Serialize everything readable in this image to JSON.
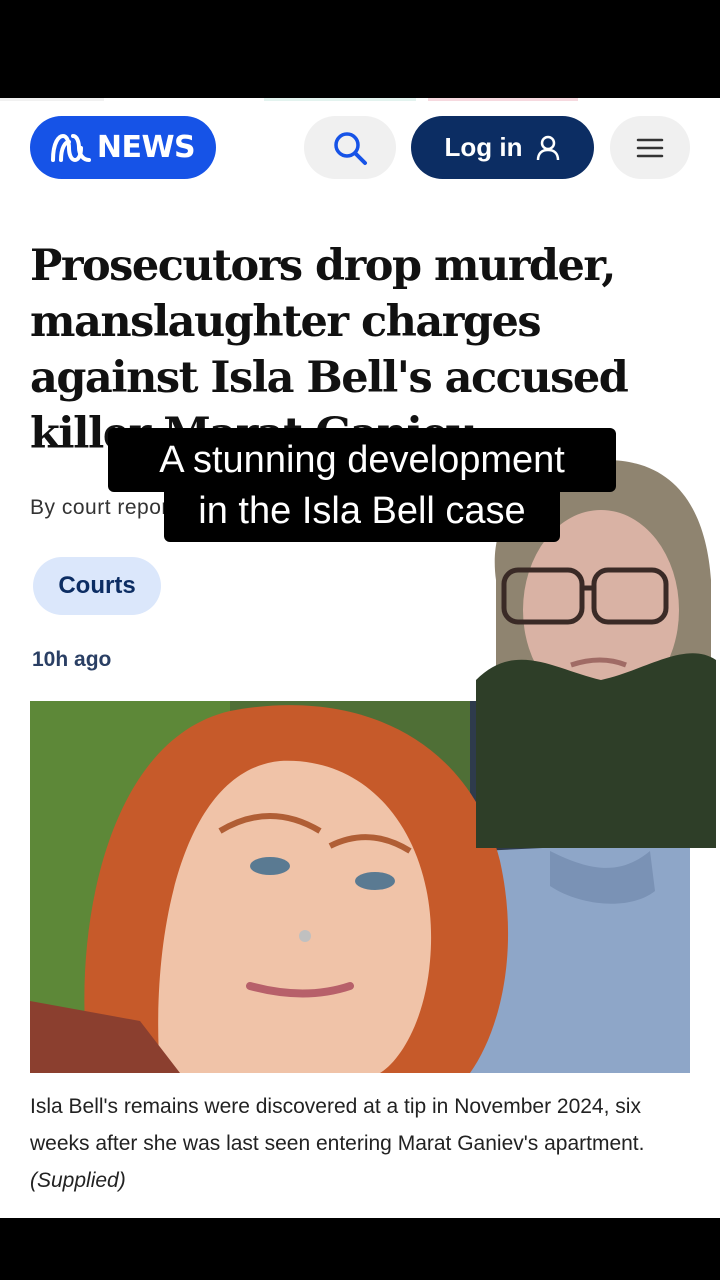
{
  "header": {
    "logo_text": "NEWS",
    "login_label": "Log in"
  },
  "article": {
    "headline": "Prosecutors drop murder, manslaughter charges against Isla Bell's accused killer Marat Ganiev",
    "byline": "By court reporter Danny Tran",
    "tag": "Courts",
    "time": "10h ago",
    "caption": "Isla Bell's remains were discovered at a tip in November 2024, six weeks after she was last seen entering Marat Ganiev's apartment.",
    "caption_credit": "(Supplied)"
  },
  "overlay": {
    "line1": "A stunning development",
    "line2": "in the Isla Bell case"
  },
  "colors": {
    "brand_blue": "#1653e7",
    "navy": "#0c2d63",
    "tag_bg": "#dbe7fb"
  },
  "icons": {
    "logo": "abc-logo-icon",
    "search": "search-icon",
    "login": "user-icon",
    "menu": "hamburger-menu-icon"
  }
}
